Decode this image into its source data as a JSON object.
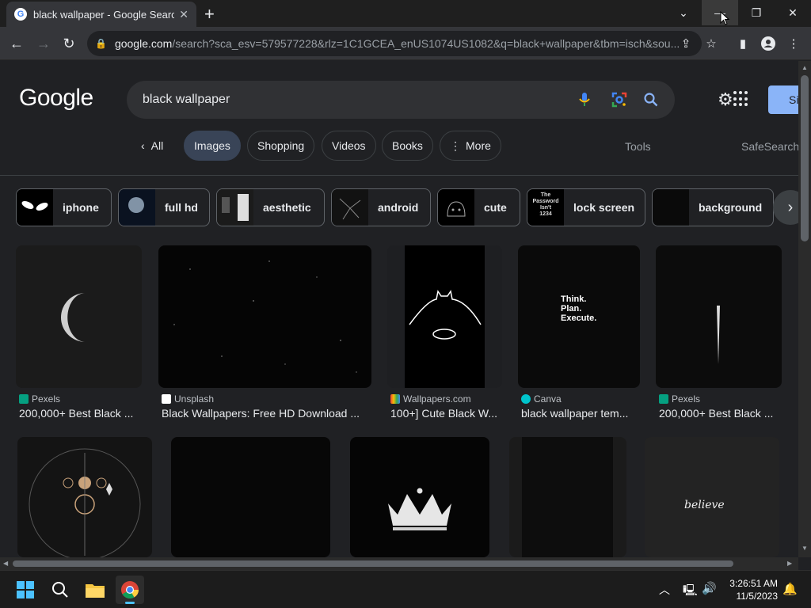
{
  "browser": {
    "tab_title": "black wallpaper - Google Search",
    "address_host": "google.com",
    "address_path": "/search?sca_esv=579577228&rlz=1C1GCEA_enUS1074US1082&q=black+wallpaper&tbm=isch&sou..."
  },
  "search": {
    "logo": "Google",
    "query": "black wallpaper",
    "signin_label": "Si"
  },
  "filters": {
    "all": "All",
    "images": "Images",
    "shopping": "Shopping",
    "videos": "Videos",
    "books": "Books",
    "more": "More",
    "tools": "Tools",
    "safesearch": "SafeSearch"
  },
  "chips": [
    "iphone",
    "full hd",
    "aesthetic",
    "android",
    "cute",
    "lock screen",
    "background"
  ],
  "results": [
    {
      "source": "Pexels",
      "title": "200,000+ Best Black ..."
    },
    {
      "source": "Unsplash",
      "title": "Black Wallpapers: Free HD Download ..."
    },
    {
      "source": "Wallpapers.com",
      "title": "100+] Cute Black W..."
    },
    {
      "source": "Canva",
      "title": "black wallpaper tem..."
    },
    {
      "source": "Pexels",
      "title": "200,000+ Best Black ..."
    }
  ],
  "image_text": {
    "think": "Think.",
    "plan": "Plan.",
    "execute": "Execute.",
    "believe": "believe",
    "lockscreen_line1": "The",
    "lockscreen_line2": "Password",
    "lockscreen_line3": "Isn't",
    "lockscreen_line4": "1234"
  },
  "taskbar": {
    "time": "3:26:51 AM",
    "date": "11/5/2023"
  },
  "colors": {
    "accent": "#8ab4f8",
    "active_filter": "#394457",
    "background": "#202124"
  }
}
